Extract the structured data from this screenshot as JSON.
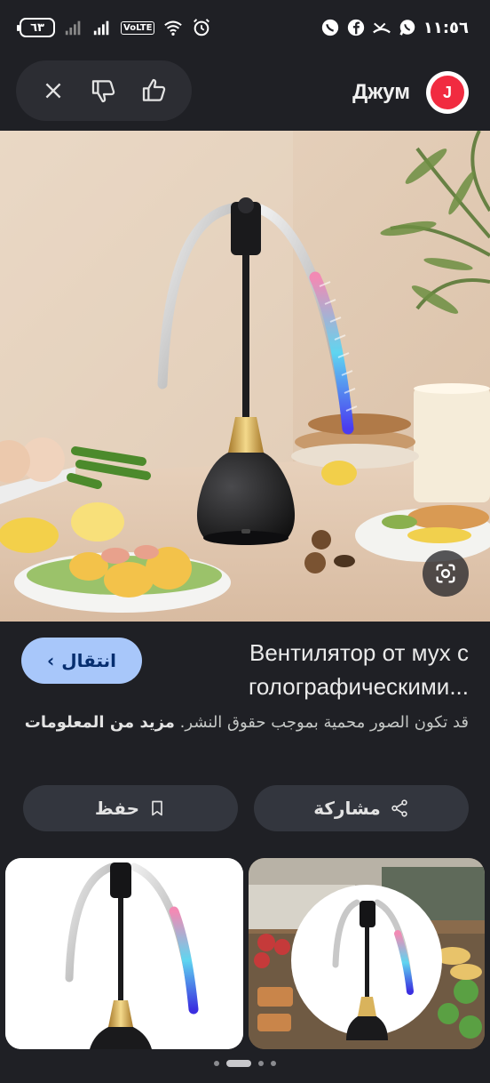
{
  "status_bar": {
    "battery": "٦٣",
    "network_badge": "VoLTE",
    "time": "١١:٥٦"
  },
  "header": {
    "brand_name": "Джум",
    "brand_logo_letter": "J"
  },
  "feedback_icons": [
    "close-icon",
    "thumbs-down-icon",
    "thumbs-up-icon"
  ],
  "result": {
    "visit_label": "انتقال",
    "title": "Вентилятор от мух с голографическими...",
    "copyright_text": "قد تكون الصور محمية بموجب حقوق النشر.",
    "more_info_label": "مزيد من المعلومات"
  },
  "actions": {
    "share_label": "مشاركة",
    "save_label": "حفظ"
  },
  "colors": {
    "background": "#1f2025",
    "accent_button": "#a8c7fa",
    "brand": "#f12b40"
  },
  "carousel": {
    "dot_count": 4,
    "active_index": 1
  }
}
